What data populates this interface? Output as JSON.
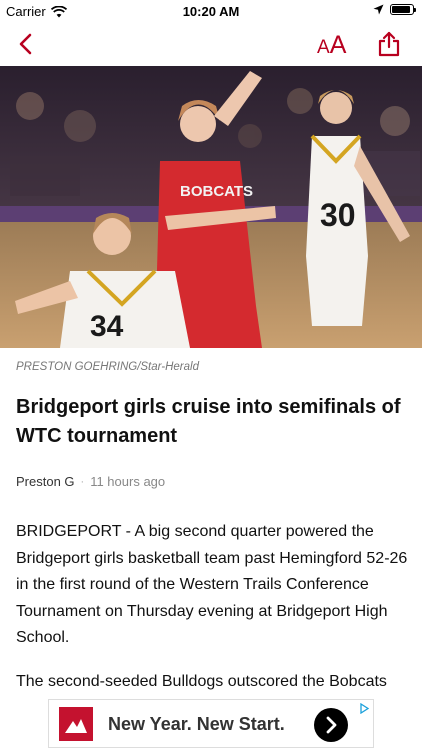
{
  "status_bar": {
    "carrier": "Carrier",
    "time": "10:20 AM",
    "battery_level": 0.9
  },
  "nav": {
    "back_icon": "chevron-left-icon",
    "font_size_small": "A",
    "font_size_large": "A",
    "share_icon": "share-icon",
    "accent_color": "#b8001f"
  },
  "article": {
    "image_credit": "PRESTON GOEHRING/Star-Herald",
    "headline": "Bridgeport girls cruise into semifinals of WTC tournament",
    "author": "Preston G",
    "separator": "·",
    "published": "11 hours ago",
    "paragraphs": [
      "BRIDGEPORT - A big second quarter powered the Bridgeport girls basketball team past Hemingford 52-26 in the first round of the Western Trails Conference Tournament on Thursday evening at Bridgeport High School.",
      "The second-seeded Bulldogs outscored the Bobcats"
    ]
  },
  "ad": {
    "headline": "New Year. New Start.",
    "brand_color": "#c4122f"
  }
}
